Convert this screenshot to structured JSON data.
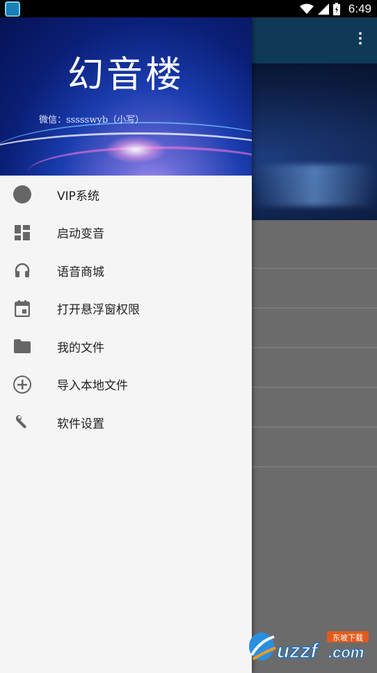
{
  "status_bar": {
    "time": "6:49"
  },
  "drawer": {
    "title": "幻音楼",
    "wechat": "微信：ssssswyb（小写）",
    "items": [
      {
        "label": "VIP系统",
        "icon": "circle-icon"
      },
      {
        "label": "启动变音",
        "icon": "dashboard-icon"
      },
      {
        "label": "语音商城",
        "icon": "headphones-icon"
      },
      {
        "label": "打开悬浮窗权限",
        "icon": "calendar-icon"
      },
      {
        "label": "我的文件",
        "icon": "folder-icon"
      },
      {
        "label": "导入本地文件",
        "icon": "add-circle-icon"
      },
      {
        "label": "软件设置",
        "icon": "wrench-icon"
      }
    ]
  },
  "watermark": {
    "brand": "uzzf.com",
    "tag": "东坡下载"
  },
  "colors": {
    "drawer_bg": "#f5f5f5",
    "icon_gray": "#666666",
    "dim_bg": "#6b6b6b"
  }
}
